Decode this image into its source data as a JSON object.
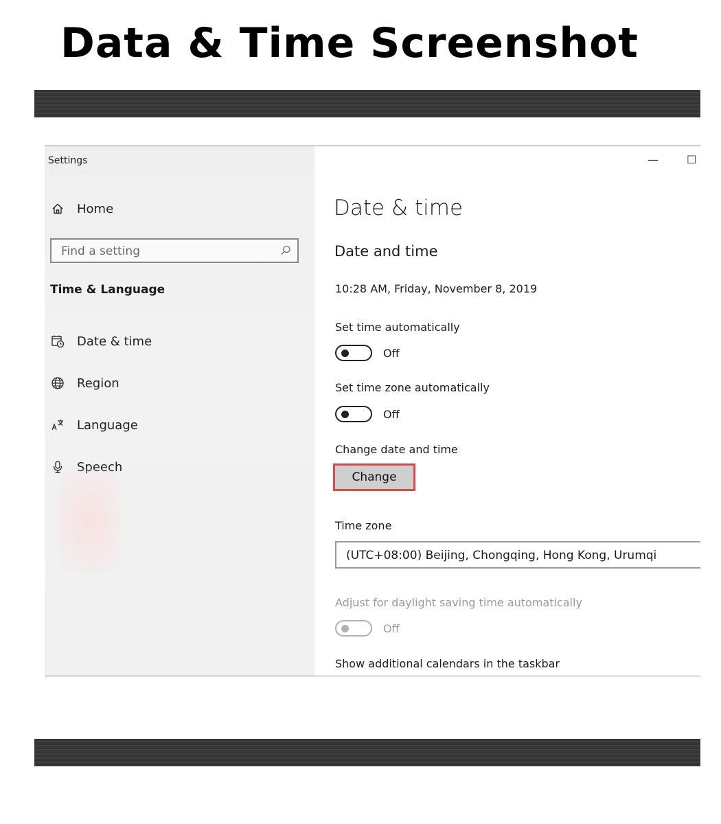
{
  "heading": "Data & Time Screenshot",
  "window": {
    "title": "Settings",
    "controls": {
      "minimize": "—",
      "maximize": "☐"
    }
  },
  "sidebar": {
    "home_label": "Home",
    "search": {
      "placeholder": "Find a setting",
      "icon": "search-icon"
    },
    "section_label": "Time & Language",
    "items": [
      {
        "label": "Date & time",
        "icon": "calendar-clock-icon"
      },
      {
        "label": "Region",
        "icon": "globe-icon"
      },
      {
        "label": "Language",
        "icon": "language-icon"
      },
      {
        "label": "Speech",
        "icon": "microphone-icon"
      }
    ]
  },
  "main": {
    "title": "Date & time",
    "subtitle": "Date and time",
    "current_datetime": "10:28 AM, Friday, November 8, 2019",
    "set_time_auto": {
      "label": "Set time automatically",
      "state": "Off"
    },
    "set_timezone_auto": {
      "label": "Set time zone automatically",
      "state": "Off"
    },
    "change_section": {
      "label": "Change date and time",
      "button": "Change"
    },
    "time_zone": {
      "label": "Time zone",
      "value": "(UTC+08:00) Beijing, Chongqing, Hong Kong, Urumqi"
    },
    "daylight": {
      "label": "Adjust for daylight saving time automatically",
      "state": "Off"
    },
    "calendars_label": "Show additional calendars in the taskbar"
  },
  "colors": {
    "highlight_border": "#e04848",
    "sidebar_bg": "#f0f0f0",
    "button_bg": "#cfcfcf"
  }
}
